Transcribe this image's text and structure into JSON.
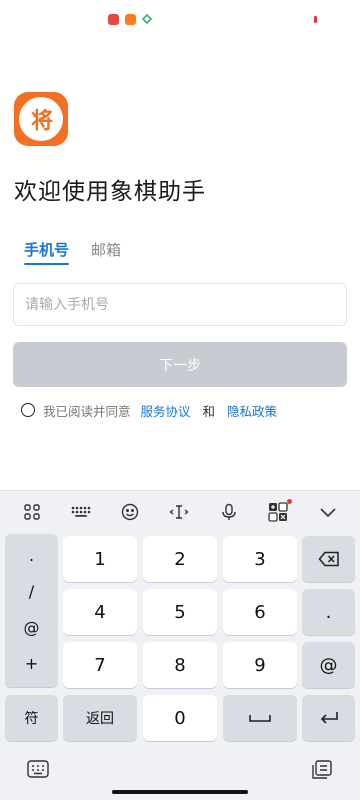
{
  "app": {
    "logo_text": "将",
    "welcome_title": "欢迎使用象棋助手"
  },
  "tabs": [
    {
      "label": "手机号",
      "active": true
    },
    {
      "label": "邮箱",
      "active": false
    }
  ],
  "phone_input": {
    "placeholder": "请输入手机号",
    "value": ""
  },
  "next_button": {
    "label": "下一步",
    "enabled": false
  },
  "agreement": {
    "prefix": "我已阅读并同意",
    "terms_link": "服务协议",
    "and": "和",
    "privacy_link": "隐私政策",
    "checked": false
  },
  "keyboard": {
    "toolbar": [
      "grid-icon",
      "keyboard-dots-icon",
      "emoji-icon",
      "cursor-icon",
      "microphone-icon",
      "calculator-icon",
      "collapse-icon"
    ],
    "symbols": [
      ".",
      "/",
      "@",
      "+"
    ],
    "digits": [
      "1",
      "2",
      "3",
      "4",
      "5",
      "6",
      "7",
      "8",
      "9",
      "0"
    ],
    "right_keys": [
      "backspace-icon",
      ".",
      "@",
      "enter-icon"
    ],
    "symbol_key": "符",
    "back_key": "返回",
    "space_key": "space-icon"
  },
  "colors": {
    "accent": "#1677d7",
    "logo_bg": "#f36f21",
    "button_disabled": "#c8cbd1",
    "keyboard_bg": "#eff1f5"
  }
}
